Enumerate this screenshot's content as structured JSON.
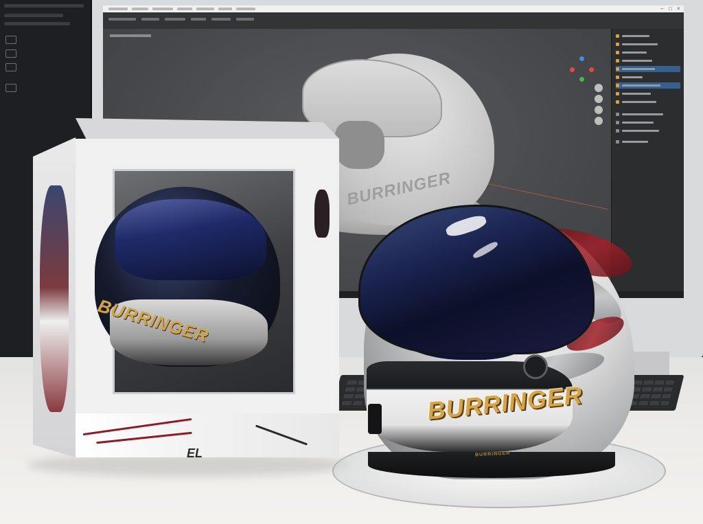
{
  "scene": {
    "description_tags": [
      "desk",
      "monitor",
      "3d-viewport",
      "packaging-box",
      "helmet",
      "display-stand"
    ]
  },
  "screen_model": {
    "engraved_text": "BURRINGER"
  },
  "box": {
    "helmet_brand": "BURRINGER",
    "front_code": "EL"
  },
  "helmet": {
    "brand": "BURRINGER",
    "tagline": "BURRINGER"
  },
  "colors": {
    "accent_gold": "#d3a449",
    "flame_red": "#a32029",
    "visor_blue": "#1a2350",
    "ui_selection": "#3b5e8a"
  }
}
